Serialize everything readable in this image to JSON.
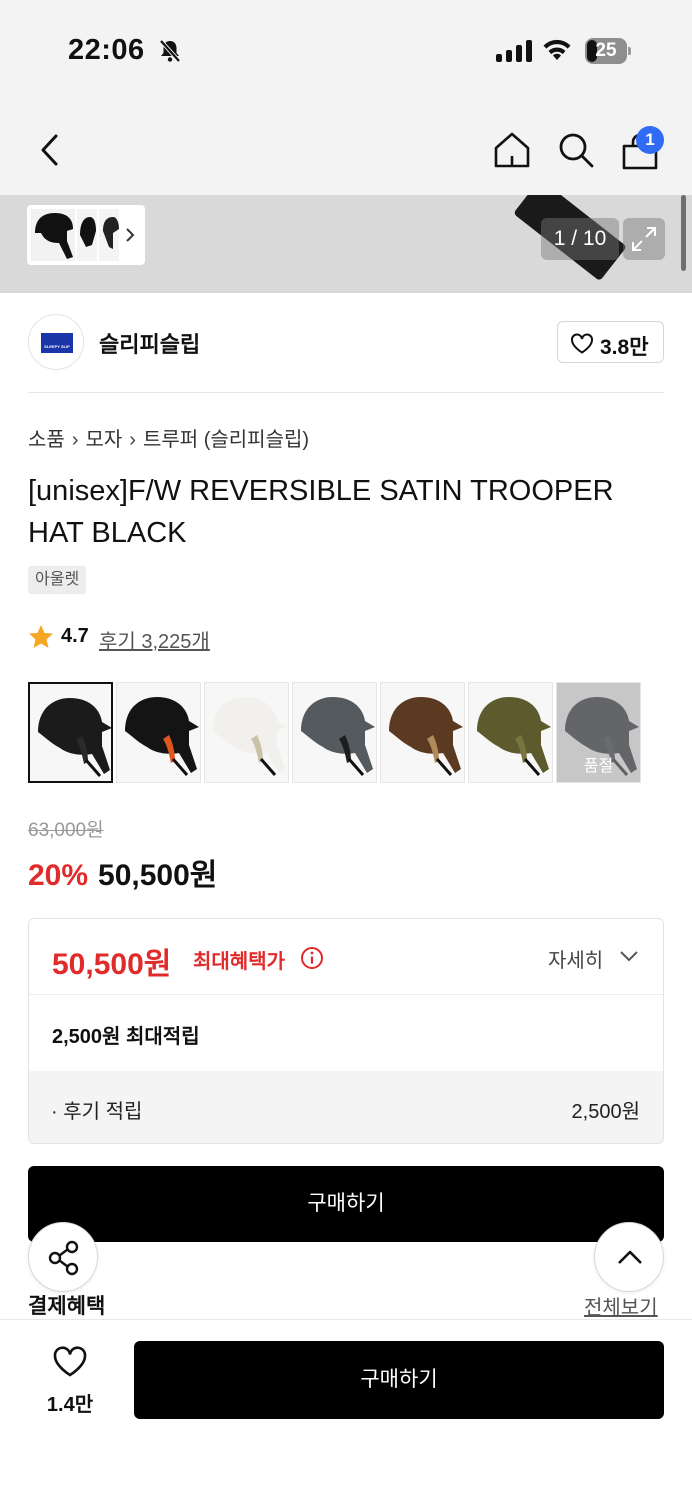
{
  "status_bar": {
    "time": "22:06",
    "battery": "25"
  },
  "nav": {
    "cart_count": "1"
  },
  "gallery": {
    "counter": "1 / 10"
  },
  "brand": {
    "name": "슬리피슬립",
    "logo_text": "SLEEPY SLIP",
    "like_count": "3.8만"
  },
  "breadcrumb": {
    "items": [
      "소품",
      "모자",
      "트루퍼 (슬리피슬립)"
    ]
  },
  "product": {
    "title": "[unisex]F/W REVERSIBLE SATIN TROOPER HAT BLACK",
    "tag": "아울렛",
    "rating": "4.7",
    "reviews": "후기 3,225개"
  },
  "variants": {
    "soldout_label": "품절",
    "items": [
      {
        "color": "#1b1b1b",
        "accent": "#2a2a2a",
        "selected": true
      },
      {
        "color": "#141414",
        "accent": "#e0561e"
      },
      {
        "color": "#f2f0ec",
        "accent": "#c9c2a8"
      },
      {
        "color": "#545a5e",
        "accent": "#1e1e1e"
      },
      {
        "color": "#5c3a22",
        "accent": "#b08a5a"
      },
      {
        "color": "#5d5a2e",
        "accent": "#7a7540"
      },
      {
        "color": "#1a1d26",
        "accent": "#2a2d36",
        "soldout": true
      }
    ]
  },
  "price": {
    "original": "63,000원",
    "discount": "20%",
    "sale": "50,500원"
  },
  "benefit": {
    "max_price": "50,500원",
    "max_label": "최대혜택가",
    "detail": "자세히",
    "points": "2,500원 최대적립",
    "review_label": "· 후기 적립",
    "review_amount": "2,500원"
  },
  "buttons": {
    "buy_main": "구매하기",
    "buy_bottom": "구매하기"
  },
  "payment": {
    "title": "결제혜택",
    "view_all": "전체보기"
  },
  "bottom": {
    "like_count": "1.4만"
  }
}
